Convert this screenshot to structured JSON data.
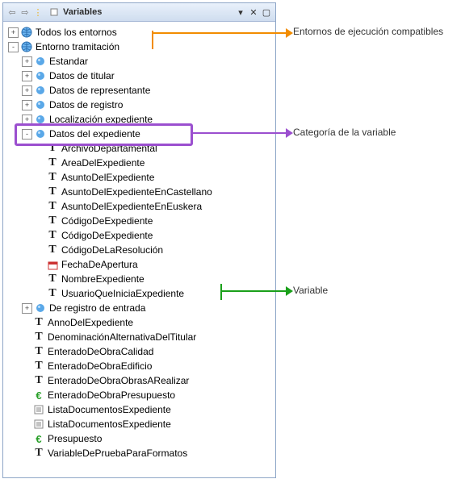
{
  "panel": {
    "title": "Variables",
    "nav_back_label": "back",
    "nav_forward_label": "forward",
    "nav_menu_label": "menu",
    "pin_label": "pin",
    "close_label": "close"
  },
  "colors": {
    "orange": "#f28c00",
    "purple": "#9b4fcf",
    "green": "#1aa01a"
  },
  "annotations": {
    "env": "Entornos de ejecución compatibles",
    "cat": "Categoría de la variable",
    "var": "Variable"
  },
  "tree": {
    "root1": {
      "label": "Todos los entornos",
      "exp": "+"
    },
    "root2": {
      "label": "Entorno tramitación",
      "exp": "-",
      "children": {
        "c0": {
          "label": "Estandar",
          "exp": "+"
        },
        "c1": {
          "label": "Datos de titular",
          "exp": "+"
        },
        "c2": {
          "label": "Datos de representante",
          "exp": "+"
        },
        "c3": {
          "label": "Datos de registro",
          "exp": "+"
        },
        "c4": {
          "label": "Localización expediente",
          "exp": "+"
        },
        "c5": {
          "label": "Datos del expediente",
          "exp": "-",
          "children": {
            "v0": {
              "label": "ArchivoDepartamental",
              "icon": "T"
            },
            "v1": {
              "label": "AreaDelExpediente",
              "icon": "T"
            },
            "v2": {
              "label": "AsuntoDelExpediente",
              "icon": "T"
            },
            "v3": {
              "label": "AsuntoDelExpedienteEnCastellano",
              "icon": "T"
            },
            "v4": {
              "label": "AsuntoDelExpedienteEnEuskera",
              "icon": "T"
            },
            "v5": {
              "label": "CódigoDeExpediente",
              "icon": "T"
            },
            "v6": {
              "label": "CódigoDeExpediente",
              "icon": "T"
            },
            "v7": {
              "label": "CódigoDeLaResolución",
              "icon": "T"
            },
            "v8": {
              "label": "FechaDeApertura",
              "icon": "cal"
            },
            "v9": {
              "label": "NombreExpediente",
              "icon": "T"
            },
            "v10": {
              "label": "UsuarioQueIniciaExpediente",
              "icon": "T"
            }
          }
        },
        "c6": {
          "label": "De registro de entrada",
          "exp": "+"
        },
        "f0": {
          "label": "AnnoDelExpediente",
          "icon": "T"
        },
        "f1": {
          "label": "DenominaciónAlternativaDelTitular",
          "icon": "T"
        },
        "f2": {
          "label": "EnteradoDeObraCalidad",
          "icon": "T"
        },
        "f3": {
          "label": "EnteradoDeObraEdificio",
          "icon": "T"
        },
        "f4": {
          "label": "EnteradoDeObraObrasARealizar",
          "icon": "T"
        },
        "f5": {
          "label": "EnteradoDeObraPresupuesto",
          "icon": "euro"
        },
        "f6": {
          "label": "ListaDocumentosExpediente",
          "icon": "doc"
        },
        "f7": {
          "label": "ListaDocumentosExpediente",
          "icon": "doc"
        },
        "f8": {
          "label": "Presupuesto",
          "icon": "euro"
        },
        "f9": {
          "label": "VariableDePruebaParaFormatos",
          "icon": "T"
        }
      }
    }
  }
}
